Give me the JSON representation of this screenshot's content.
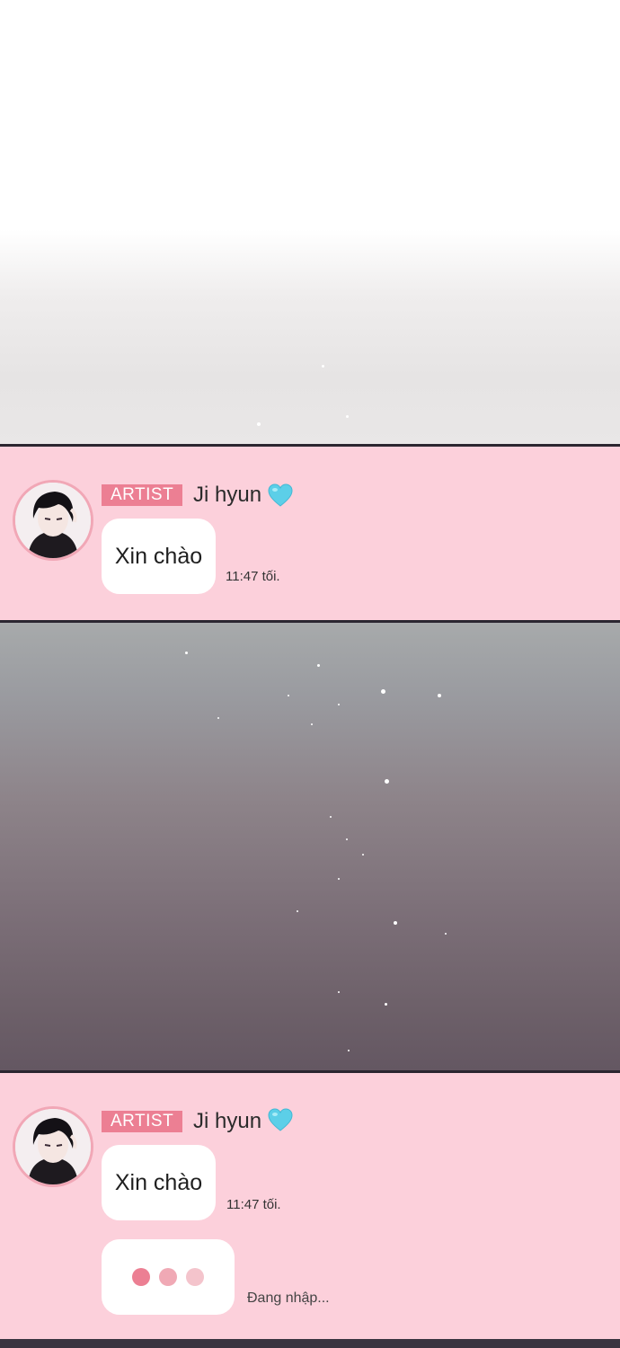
{
  "messages": [
    {
      "badge": "ARTIST",
      "sender": "Ji hyun",
      "text": "Xin chào",
      "time": "11:47 tối."
    },
    {
      "badge": "ARTIST",
      "sender": "Ji hyun",
      "text": "Xin chào",
      "time": "11:47 tối.",
      "typing_status": "Đang nhập..."
    }
  ],
  "icons": {
    "heart": "blue-heart-icon",
    "typing": "typing-dots-icon"
  },
  "colors": {
    "chat_background": "#fcd0db",
    "badge": "#ec7f93",
    "heart": "#5ccfe8",
    "typing_dots": [
      "#ec7f93",
      "#f0a9b5",
      "#f4c4cc"
    ]
  }
}
